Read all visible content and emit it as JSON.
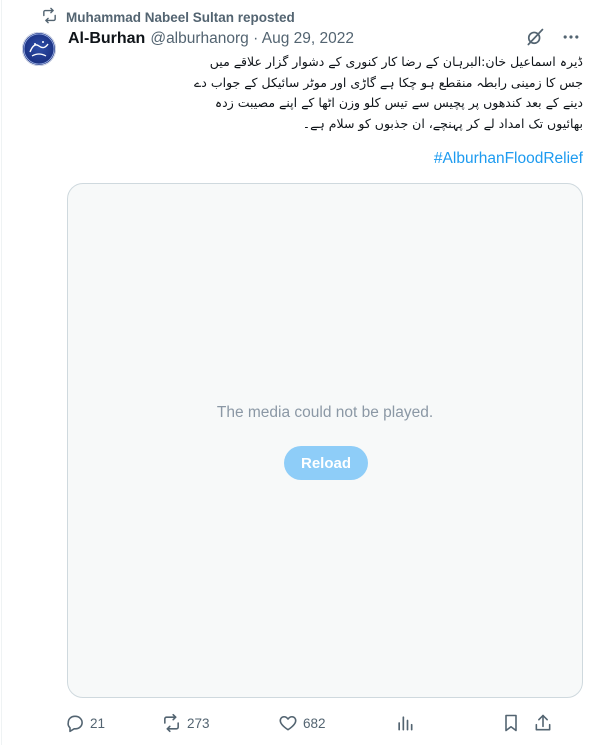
{
  "repost": {
    "icon": "repost-icon",
    "text": "Muhammad Nabeel Sultan reposted"
  },
  "author": {
    "avatar_text": "البرهان",
    "name": "Al-Burhan",
    "handle": "@alburhanorg",
    "separator": "·",
    "date": "Aug 29, 2022"
  },
  "header_icons": [
    "grok-icon",
    "more-icon"
  ],
  "tweet": {
    "lines": [
      "ڈیرہ اسماعیل خان:البرہان کے رضا کار کنوری کے دشوار گزار علاقے میں",
      "جس کا زمینی رابطہ منقطع ہو چکا ہے گاڑی اور موٹر سائیکل کے جواب دے",
      "دینے کے بعد کندھوں پر پچیس سے تیس کلو وزن اٹھا کے اپنے مصیبت زدہ",
      "بھائیوں تک امداد لے کر پہنچے، ان جذبوں کو سلام ہے۔"
    ],
    "hashtag": "#AlburhanFloodRelief"
  },
  "media": {
    "message": "The media could not be played.",
    "reload_label": "Reload",
    "background": "#f7f9f9",
    "reload_color": "#8ecdf8"
  },
  "actions": {
    "replies": "21",
    "reposts": "273",
    "likes": "682"
  },
  "colors": {
    "accent": "#1d9bf0",
    "secondary_text": "#536471",
    "primary_text": "#0f1419"
  }
}
